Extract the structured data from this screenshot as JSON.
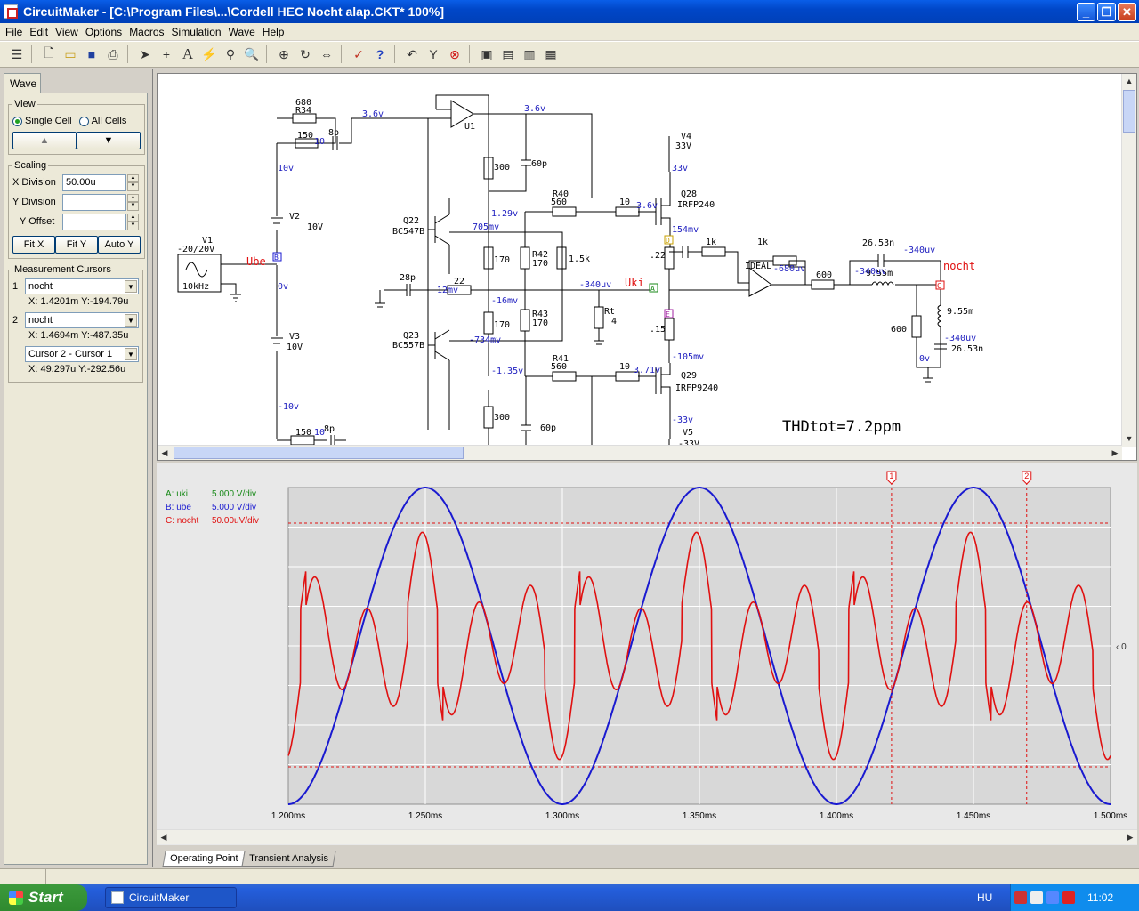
{
  "window": {
    "title": "CircuitMaker - [C:\\Program Files\\...\\Cordell HEC Nocht alap.CKT* 100%]"
  },
  "menu": [
    "File",
    "Edit",
    "View",
    "Options",
    "Macros",
    "Simulation",
    "Wave",
    "Help"
  ],
  "toolbar_icons": [
    "panel-toggle-icon",
    "new-file-icon",
    "open-file-icon",
    "save-icon",
    "print-icon",
    "arrow-tool-icon",
    "wire-tool-icon",
    "text-tool-icon",
    "probe-tool-icon",
    "probe2-tool-icon",
    "zoom-icon",
    "zoom-area-icon",
    "rotate-icon",
    "mirror-icon",
    "check-icon",
    "help-icon",
    "undo-icon",
    "trace-icon",
    "stop-icon",
    "run-icon",
    "step-icon",
    "analysis-icon",
    "wave-icon"
  ],
  "left_panel": {
    "tab": "Wave",
    "view": {
      "legend": "View",
      "single_cell": "Single Cell",
      "all_cells": "All Cells",
      "up": "▲",
      "down": "▼"
    },
    "scaling": {
      "legend": "Scaling",
      "x_division_label": "X Division",
      "x_division_value": "50.00u",
      "y_division_label": "Y Division",
      "y_offset_label": "Y Offset",
      "fit_x": "Fit X",
      "fit_y": "Fit Y",
      "auto_y": "Auto Y"
    },
    "cursors": {
      "legend": "Measurement Cursors",
      "c1_index": "1",
      "c1_value": "nocht",
      "c1_xy": "X: 1.4201m  Y:-194.79u",
      "c2_index": "2",
      "c2_value": "nocht",
      "c2_xy": "X: 1.4694m  Y:-487.35u",
      "diff_value": "Cursor 2 - Cursor 1",
      "diff_xy": "X: 49.297u  Y:-292.56u"
    }
  },
  "schematic": {
    "labels": {
      "r34": "680",
      "r34n": "R34",
      "v36a": "3.6v",
      "r150a": "150",
      "c8pa": "8p",
      "r10a": "10",
      "v10": "10v",
      "v2": "V2",
      "v2val": "10V",
      "v1": "V1",
      "v1amp": "-20/20V",
      "v1f": "10kHz",
      "ube": "Ube",
      "ov": "0v",
      "v3": "V3",
      "v3val": "10V",
      "vm10": "-10v",
      "r150b": "150",
      "c8pb": "8p",
      "r10b": "10",
      "u1": "U1",
      "v36b": "3.6v",
      "r300a": "300",
      "c60a": "60p",
      "r40": "R40",
      "r560a": "560",
      "v129": "1.29v",
      "v705": "705mv",
      "q22": "Q22",
      "q22t": "BC547B",
      "r170a": "170",
      "r42": "R42",
      "r42v": "170",
      "r15k": "1.5k",
      "c28": "28p",
      "r22": "22",
      "v12": "12mv",
      "vm16": "-16mv",
      "vm340a": "-340uv",
      "uki": "Uki",
      "rt": "Rt",
      "rtv": "4",
      "q23": "Q23",
      "q23t": "BC557B",
      "r170b": "170",
      "r43": "R43",
      "r43v": "170",
      "vm734": "-734mv",
      "vm135": "-1.35v",
      "r41": "R41",
      "r560b": "560",
      "r300b": "300",
      "c60b": "60p",
      "v4": "V4",
      "v4v": "33V",
      "v33": "33v",
      "r10c": "10",
      "v36c": "3.6v",
      "q28": "Q28",
      "q28t": "IRFP240",
      "v154": "154mv",
      "r022": ".22",
      "r015": ".15",
      "vm105": "-105mv",
      "r10d": "10",
      "v371": "3.71v",
      "q29": "Q29",
      "q29t": "IRFP9240",
      "vm33": "-33v",
      "v5": "V5",
      "v5v": "-33V",
      "r1ka": "1k",
      "r1kb": "1k",
      "ideal": "IDEAL",
      "vm680": "-680uv",
      "r600a": "600",
      "vm340b": "-340uv",
      "l955a": "9.55m",
      "c2653a": "26.53n",
      "vm340c": "-340uv",
      "nocht": "nocht",
      "l955b": "9.55m",
      "r600b": "600",
      "vm340d": "-340uv",
      "ov2": "0v",
      "c2653b": "26.53n",
      "thd": "THDtot=7.2ppm",
      "probe_a": "A",
      "probe_b": "B",
      "probe_c": "C",
      "probe_d": "D",
      "probe_e": "E"
    }
  },
  "wave": {
    "legend": [
      {
        "label": "A: uki",
        "scale": "5.000 V/div",
        "color": "#1a8a1a"
      },
      {
        "label": "B: ube",
        "scale": "5.000 V/div",
        "color": "#1a1ad0"
      },
      {
        "label": "C: nocht",
        "scale": "50.00uV/div",
        "color": "#e01010"
      }
    ],
    "zero_label": "0",
    "cursor1": "1",
    "cursor2": "2"
  },
  "chart_data": {
    "type": "line",
    "x_ticks": [
      "1.200ms",
      "1.250ms",
      "1.300ms",
      "1.350ms",
      "1.400ms",
      "1.450ms",
      "1.500ms"
    ],
    "xlim": [
      1.2,
      1.5
    ],
    "x_unit": "ms",
    "grid": true,
    "cursors_x": [
      1.4201,
      1.4694
    ],
    "series": [
      {
        "name": "B: ube",
        "color": "#1a1ad0",
        "kind": "sine",
        "amplitude_div": 4,
        "period": 0.1,
        "peak_at": 1.25
      },
      {
        "name": "C: nocht",
        "color": "#e01010",
        "kind": "distortion",
        "scale": "50.00uV/div"
      }
    ]
  },
  "bottom_tabs": [
    "Operating Point",
    "Transient Analysis"
  ],
  "taskbar": {
    "start": "Start",
    "item": "CircuitMaker",
    "lang": "HU",
    "clock": "11:02"
  }
}
